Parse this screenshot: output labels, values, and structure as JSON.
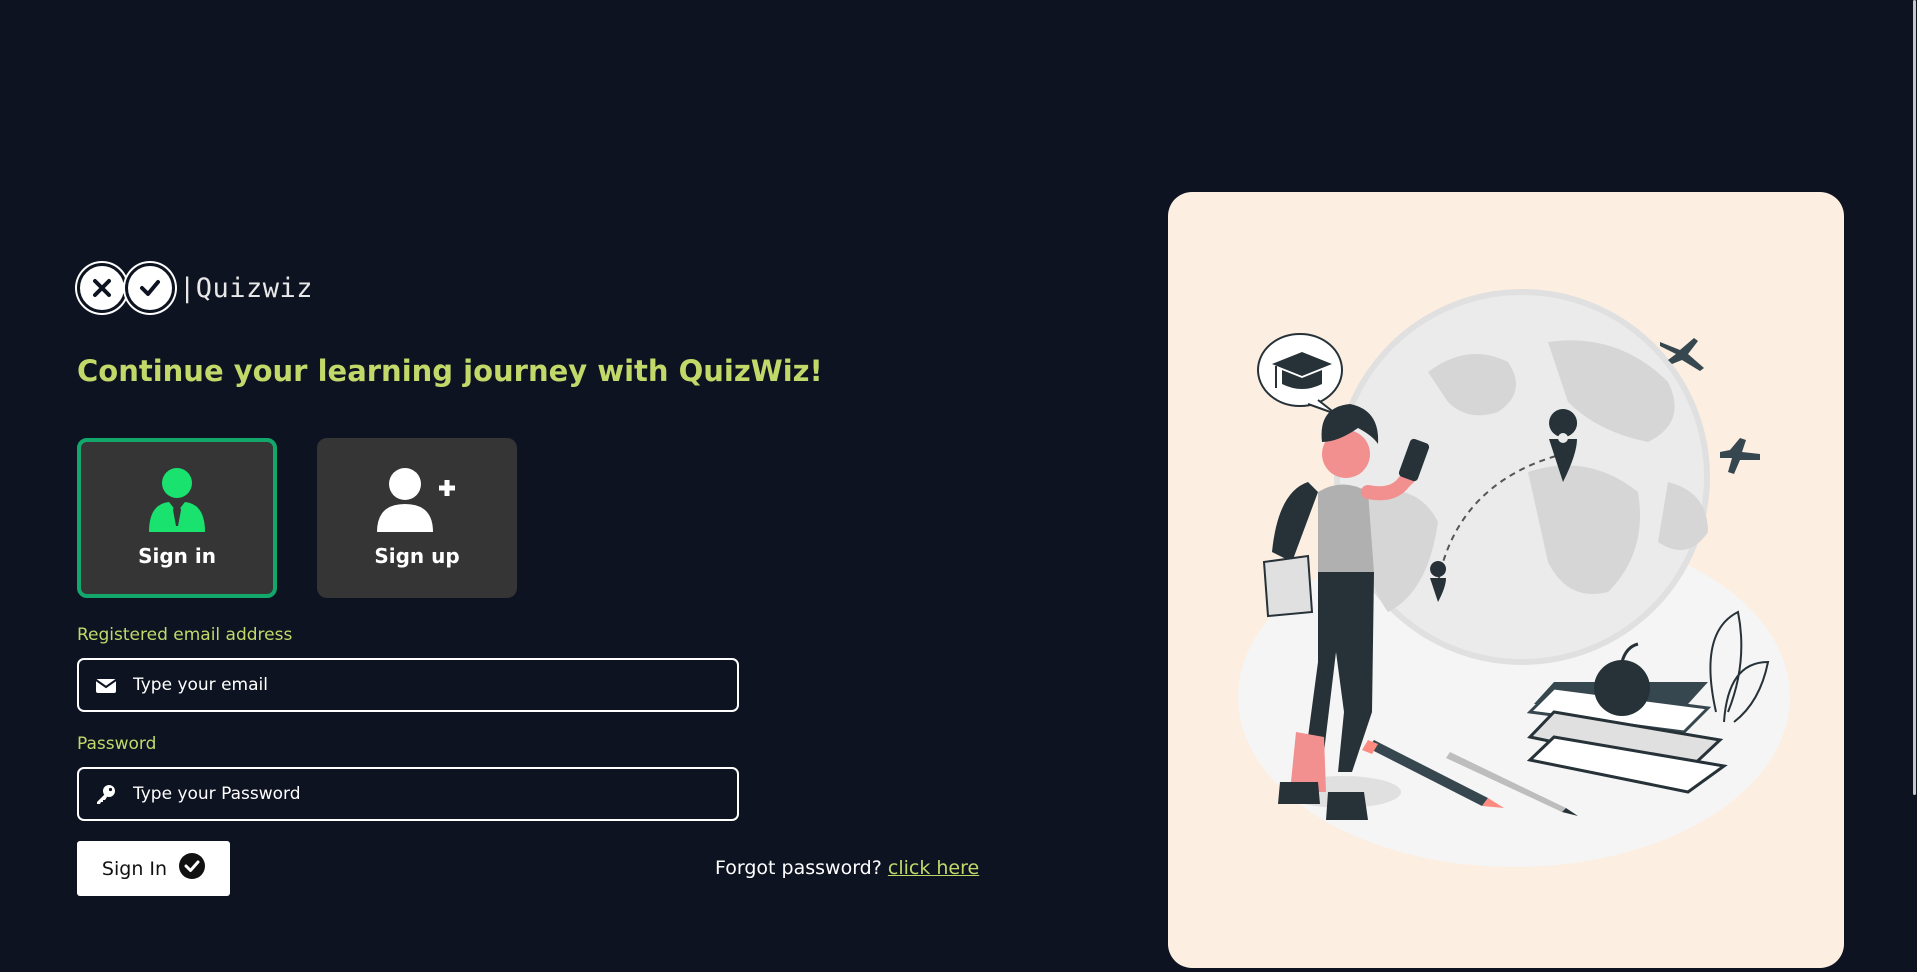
{
  "app": {
    "brand_name": "|Quizwiz",
    "logo_icons": [
      "close-circle-icon",
      "check-circle-icon"
    ]
  },
  "headline": "Continue your learning journey with QuizWiz!",
  "auth_tabs": [
    {
      "label": "Sign in",
      "icon": "user-tie-icon",
      "active": true
    },
    {
      "label": "Sign up",
      "icon": "user-plus-icon",
      "active": false
    }
  ],
  "form": {
    "email": {
      "label": "Registered email address",
      "placeholder": "Type your email",
      "icon": "envelope-icon",
      "value": ""
    },
    "password": {
      "label": "Password",
      "placeholder": "Type your Password",
      "icon": "key-icon",
      "value": ""
    },
    "submit_label": "Sign In",
    "submit_icon": "check-circle-icon",
    "forgot_text": "Forgot password?",
    "forgot_link": "click here"
  },
  "colors": {
    "background": "#0e1322",
    "accent": "#c2d96a",
    "active_border": "#13a86b",
    "active_icon": "#19e26f",
    "tile_bg": "#353535",
    "illustration_bg": "#fdeee2"
  }
}
